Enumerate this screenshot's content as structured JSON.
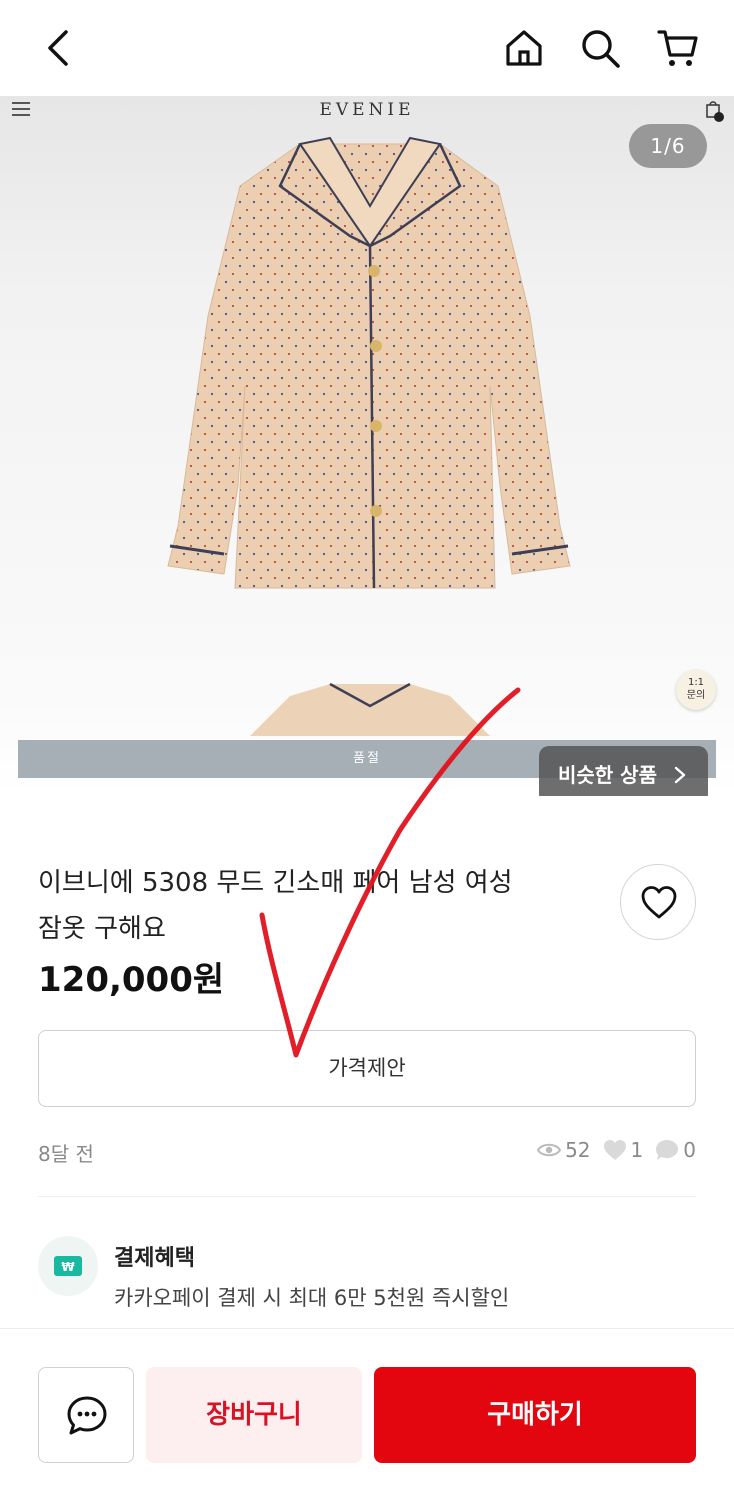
{
  "header": {
    "back_icon": "chevron-left-icon",
    "home_icon": "home-icon",
    "search_icon": "search-icon",
    "cart_icon": "cart-icon"
  },
  "gallery": {
    "brand": "EVENIE",
    "counter": "1/6",
    "qa_badge_line1": "1:1",
    "qa_badge_line2": "문의",
    "soldout_label": "품절",
    "similar_label": "비슷한 상품"
  },
  "product": {
    "title_line1": "이브니에 5308 무드 긴소매 페어 남성 여성",
    "title_line2": "잠옷 구해요",
    "price": "120,000원",
    "offer_label": "가격제안",
    "time_ago": "8달 전",
    "views": "52",
    "likes": "1",
    "chats": "0"
  },
  "benefit": {
    "title": "결제혜택",
    "description": "카카오페이 결제 시 최대 6만 5천원 즉시할인"
  },
  "bottom": {
    "cart_label": "장바구니",
    "buy_label": "구매하기"
  },
  "colors": {
    "accent_red": "#e3060f",
    "cart_bg": "#fdeff0",
    "annotation_red": "#e0121e"
  }
}
